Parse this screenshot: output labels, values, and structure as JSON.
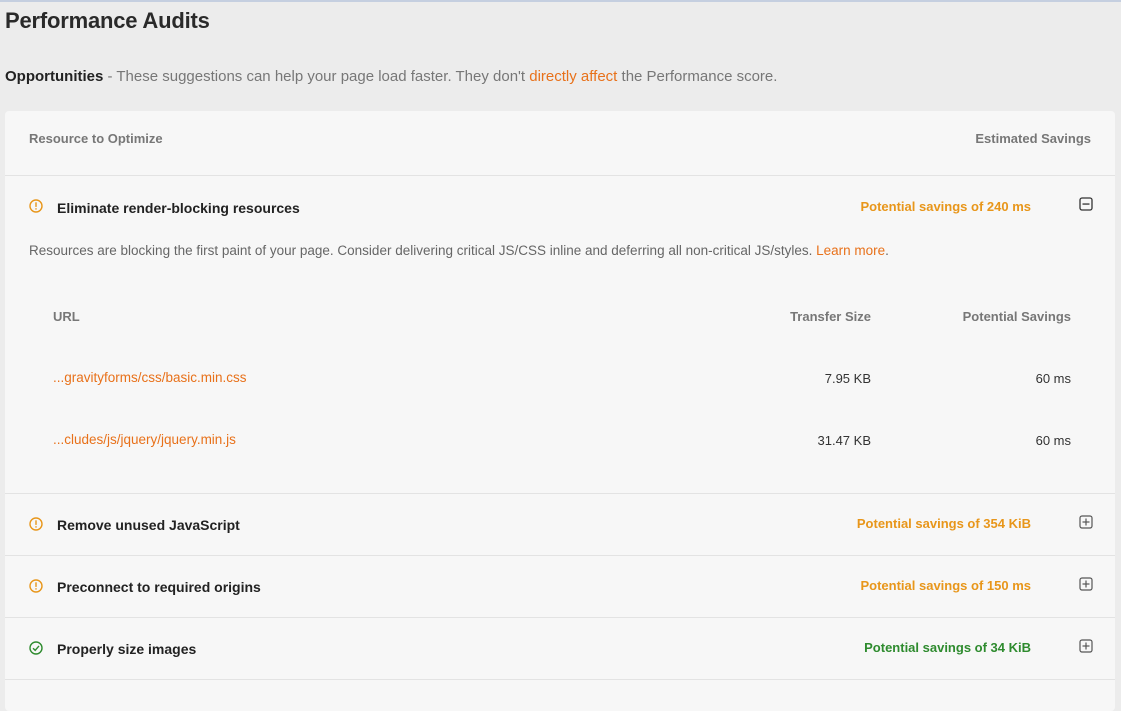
{
  "page": {
    "title": "Performance Audits",
    "subtitle_strong": "Opportunities",
    "subtitle_pre": " - These suggestions can help your page load faster. They don't ",
    "subtitle_link": "directly affect",
    "subtitle_post": " the Performance score."
  },
  "table_header": {
    "left": "Resource to Optimize",
    "right": "Estimated Savings"
  },
  "audits": [
    {
      "label": "Eliminate render-blocking resources",
      "savings": "Potential savings of 240 ms",
      "status": "warning",
      "expanded": true,
      "description": "Resources are blocking the first paint of your page. Consider delivering critical JS/CSS inline and deferring all non-critical JS/styles. ",
      "learn_more": "Learn more",
      "learn_more_suffix": ".",
      "columns": [
        "URL",
        "Transfer Size",
        "Potential Savings"
      ],
      "items": [
        {
          "url": "...gravityforms/css/basic.min.css",
          "size": "7.95 KB",
          "savings": "60 ms"
        },
        {
          "url": "...cludes/js/jquery/jquery.min.js",
          "size": "31.47 KB",
          "savings": "60 ms"
        }
      ]
    },
    {
      "label": "Remove unused JavaScript",
      "savings": "Potential savings of 354 KiB",
      "status": "warning",
      "expanded": false
    },
    {
      "label": "Preconnect to required origins",
      "savings": "Potential savings of 150 ms",
      "status": "warning",
      "expanded": false
    },
    {
      "label": "Properly size images",
      "savings": "Potential savings of 34 KiB",
      "status": "pass",
      "expanded": false
    }
  ],
  "colors": {
    "warning": "#e8961a",
    "pass": "#2e8b2e",
    "link": "#e8711a"
  },
  "icons": {
    "warning": "warning-circle-icon",
    "pass": "check-circle-icon",
    "collapse": "collapse-minus-icon",
    "expand": "expand-plus-icon"
  }
}
